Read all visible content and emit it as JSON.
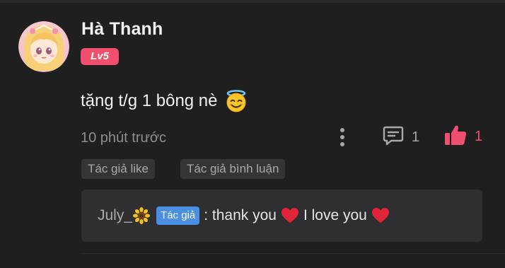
{
  "comment": {
    "username": "Hà Thanh",
    "level": "Lv5",
    "text": "tặng t/g 1 bông nè",
    "emoji": "smiling-face-with-halo",
    "time": "10 phút trước",
    "reply_count": "1",
    "like_count": "1"
  },
  "tags": {
    "author_like": "Tác giả like",
    "author_commented": "Tác giả bình luận"
  },
  "reply": {
    "author": "July_",
    "author_emoji": "sunflower",
    "author_tag": "Tác giả",
    "text_part1": ": thank you",
    "text_part2": "I love you"
  },
  "colors": {
    "background": "#1f1f20",
    "accent_pink": "#f0506e",
    "author_tag_blue": "#4a8fe2",
    "heart_red": "#e0243a"
  }
}
